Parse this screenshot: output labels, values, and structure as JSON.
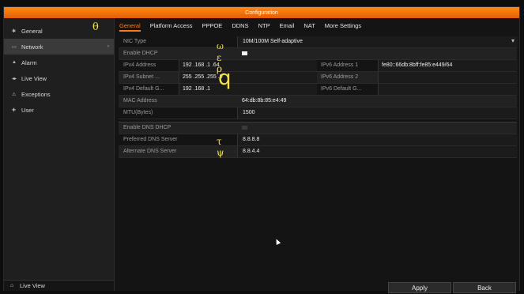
{
  "window": {
    "title": "Configuration"
  },
  "sidebar": {
    "items": [
      {
        "label": "General",
        "icon": "gear-icon"
      },
      {
        "label": "Network",
        "icon": "network-icon",
        "active": true
      },
      {
        "label": "Alarm",
        "icon": "alarm-icon"
      },
      {
        "label": "Live View",
        "icon": "live-view-icon"
      },
      {
        "label": "Exceptions",
        "icon": "warning-icon"
      },
      {
        "label": "User",
        "icon": "user-icon"
      }
    ],
    "footer": {
      "label": "Live View",
      "icon": "home-icon"
    }
  },
  "tabs": [
    "General",
    "Platform Access",
    "PPPOE",
    "DDNS",
    "NTP",
    "Email",
    "NAT",
    "More Settings"
  ],
  "form": {
    "nic_type": {
      "label": "NIC Type",
      "value": "10M/100M Self-adaptive"
    },
    "enable_dhcp": {
      "label": "Enable DHCP",
      "checked": true
    },
    "ipv4_address": {
      "label": "IPv4 Address",
      "value": "192 .168 .1   .64"
    },
    "ipv4_subnet": {
      "label": "IPv4 Subnet ...",
      "value": "255 .255 .255 .0"
    },
    "ipv4_gateway": {
      "label": "IPv4 Default G...",
      "value": "192 .168 .1"
    },
    "ipv6_address1": {
      "label": "IPv6 Address 1",
      "value": "fe80::66db:8bff:fe85:e449/64"
    },
    "ipv6_address2": {
      "label": "IPv6 Address 2",
      "value": ""
    },
    "ipv6_gateway": {
      "label": "IPv6 Default G...",
      "value": ""
    },
    "mac_address": {
      "label": "MAC Address",
      "value": "64:db:8b:85:e4:49"
    },
    "mtu": {
      "label": "MTU(Bytes)",
      "value": "1500"
    },
    "enable_dns_dhcp": {
      "label": "Enable DNS DHCP",
      "checked": false
    },
    "preferred_dns": {
      "label": "Preferred DNS Server",
      "value": "8.8.8.8"
    },
    "alternate_dns": {
      "label": "Alternate DNS Server",
      "value": "8.8.4.4"
    }
  },
  "buttons": {
    "apply": "Apply",
    "back": "Back"
  },
  "overlay_glyphs": [
    "θ",
    "ω",
    "ε",
    "ρ",
    "q",
    "τ",
    "ψ"
  ],
  "colors": {
    "accent": "#ff7a1a",
    "glyph": "#f5e24b"
  }
}
